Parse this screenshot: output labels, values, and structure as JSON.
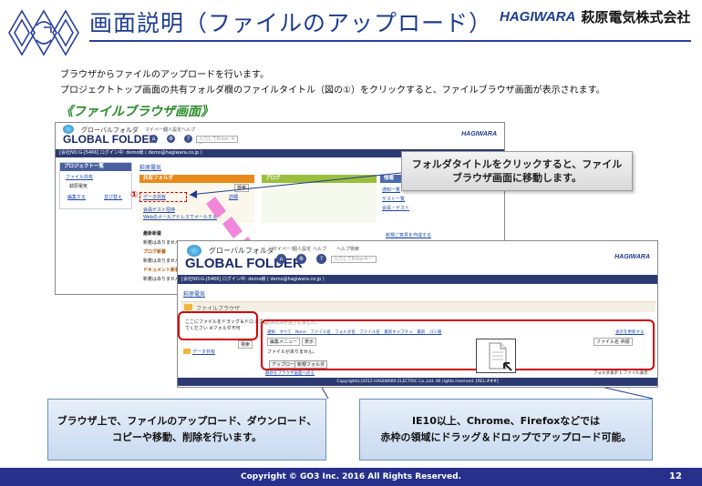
{
  "header": {
    "title": "画面説明（ファイルのアップロード）",
    "brand_en": "HAGIWARA",
    "brand_jp": "萩原電気株式会社"
  },
  "description": {
    "line1": "ブラウザからファイルのアップロードを行います。",
    "line2": "プロジェクトトップ画面の共有フォルダ欄のファイルタイトル（図の①）をクリックすると、ファイルブラウザ画面が表示されます。"
  },
  "section_heading": "《ファイルブラウザ画面》",
  "screenshot1": {
    "logo_jp": "グローバルフォルダ",
    "logo_en": "GLOBAL FOLDER",
    "nav": [
      "マイページ",
      "個人設定",
      "ヘルプ"
    ],
    "search_placeholder": "入力してEnter キー",
    "brand": "HAGIWARA",
    "user_bar": "[会社NO:G-J5466] ログイン中: demo様 ( demo@hagiwara.co.jp )",
    "project_list_label": "プロジェクト一覧",
    "project_link": "ファイル共有",
    "company_item": "萩原電気",
    "edit_link": "編集する",
    "move_link": "並び替え",
    "project_name": "萩原電気",
    "shared_folder_header": "共有フォルダ",
    "circle_one": "①",
    "data_share_link": "データ共有",
    "detail_label": "詳細",
    "sort_label": "検索",
    "new_post_label": "会員ゲスト招待",
    "notice_link": "Webのメールアドレスでメールする",
    "blog_header": "ブログ",
    "info_header": "情報",
    "info_links": [
      "通知一覧",
      "ゲスト一覧",
      "会員・ゲスト"
    ],
    "new_project_link": "新規ご意見を作成する",
    "events": [
      "最新新着",
      "ブログ新着",
      "ドキュメント新着"
    ],
    "no_items": "新着はありません。"
  },
  "callout_top": {
    "line1": "フォルダタイトルをクリックすると、ファイル",
    "line2": "ブラウザ画面に移動します。"
  },
  "screenshot2": {
    "logo_jp": "グローバルフォルダ",
    "logo_en": "GLOBAL FOLDER",
    "nav": [
      "マイページ",
      "個人設定",
      "ヘルプ",
      "ヘルプ検索"
    ],
    "search_placeholder": "入力してEnterキー",
    "brand": "HAGIWARA",
    "user_bar": "[会社NO:G-J5466] ログイン中: demo様 ( demo@hagiwara.co.jp )",
    "company": "萩原電気",
    "file_browser_title": "ファイルブラウザ",
    "drop_hint_line1": "ここにファイルをドラッグ＆ドロップし",
    "drop_hint_line2": "てください ※フォルダ不可",
    "search_btn": "検索",
    "folder_name": "データ共有",
    "loaded_message": "読み込みが完了しました。",
    "toolbar_links": "選択　すべて　None　ファイル名　フォルダ名　ファイル名　最新キャプチャ　最新　ゴミ箱",
    "toolbar_right": "表示を更新する",
    "select_label": "編集メニュー",
    "display_label": "表示",
    "sort_select": "ファイル名 昇順",
    "no_files": "ファイルがありません。",
    "upload_btn": "アップロード",
    "new_folder_btn": "新規フォルダ",
    "return_link": "最新をブラウザ画面へ戻る",
    "footer_copyright": "Copyright(c)2012 HAGIWARA ELECTRIC Co.,Ltd. All rights reserved. [REL:###]",
    "page_nav": "フォルダ表示 1 ファイル表示"
  },
  "callout_bottom_left": {
    "line1": "ブラウザ上で、ファイルのアップロード、ダウンロード、",
    "line2": "コピーや移動、削除を行います。"
  },
  "callout_bottom_right": {
    "line1": "IE10以上、Chrome、Firefoxなどでは",
    "line2": "赤枠の領域にドラッグ＆ドロップでアップロード可能。"
  },
  "footer": {
    "copyright": "Copyright © GO3 Inc. 2016  All Rights Reserved.",
    "page_number": "12"
  },
  "colors": {
    "title_blue": "#1d3c8f",
    "footer_navy": "#27318b",
    "section_green": "#2b8c2b",
    "highlight_red": "#d60000",
    "arrow_pink": "#f07ad8"
  }
}
